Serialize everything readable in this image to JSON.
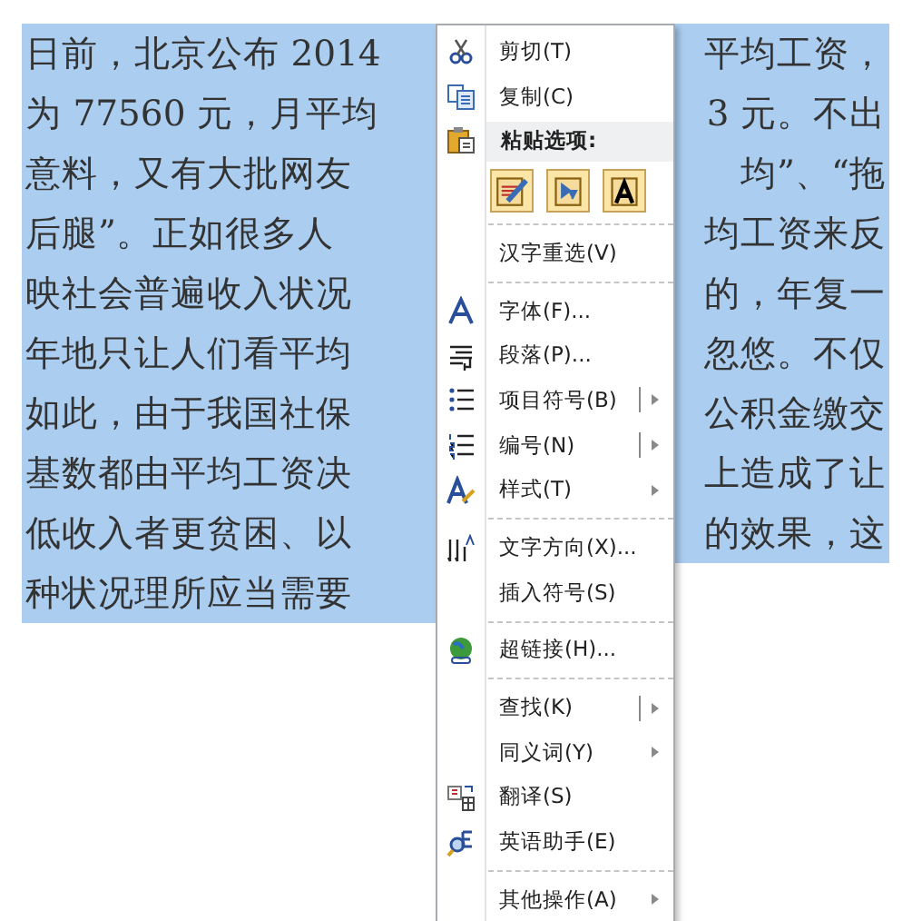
{
  "document": {
    "lines": [
      {
        "left": "日前，北京公布 2014",
        "right": "平均工资，"
      },
      {
        "left": "为 77560 元，月平均",
        "right": "3 元。不出"
      },
      {
        "left": "意料，又有大批网友",
        "right": "均”、“拖"
      },
      {
        "left": "后腿”。正如很多人",
        "right": "均工资来反"
      },
      {
        "left": "映社会普遍收入状况",
        "right": "的，年复一"
      },
      {
        "left": "年地只让人们看平均",
        "right": "忽悠。不仅"
      },
      {
        "left": "如此，由于我国社保",
        "right": "公积金缴交"
      },
      {
        "left": "基数都由平均工资决",
        "right": "上造成了让"
      },
      {
        "left": "低收入者更贫困、以",
        "right": "的效果，这"
      },
      {
        "left": "种状况理所应当需要"
      }
    ]
  },
  "context_menu": {
    "items": [
      {
        "kind": "item",
        "label": "剪切(T)"
      },
      {
        "kind": "item",
        "label": "复制(C)"
      },
      {
        "kind": "header",
        "label": "粘贴选项:"
      },
      {
        "kind": "paste_options"
      },
      {
        "kind": "separator"
      },
      {
        "kind": "item",
        "label": "汉字重选(V)"
      },
      {
        "kind": "separator"
      },
      {
        "kind": "item",
        "label": "字体(F)..."
      },
      {
        "kind": "item",
        "label": "段落(P)..."
      },
      {
        "kind": "split_submenu",
        "label": "项目符号(B)"
      },
      {
        "kind": "split_submenu",
        "label": "编号(N)"
      },
      {
        "kind": "submenu",
        "label": "样式(T)"
      },
      {
        "kind": "separator"
      },
      {
        "kind": "item",
        "label": "文字方向(X)..."
      },
      {
        "kind": "item",
        "label": "插入符号(S)"
      },
      {
        "kind": "separator"
      },
      {
        "kind": "item",
        "label": "超链接(H)..."
      },
      {
        "kind": "separator"
      },
      {
        "kind": "split_submenu",
        "label": "查找(K)"
      },
      {
        "kind": "submenu",
        "label": "同义词(Y)"
      },
      {
        "kind": "item",
        "label": "翻译(S)"
      },
      {
        "kind": "item",
        "label": "英语助手(E)"
      },
      {
        "kind": "separator"
      },
      {
        "kind": "submenu",
        "label": "其他操作(A)"
      }
    ]
  }
}
